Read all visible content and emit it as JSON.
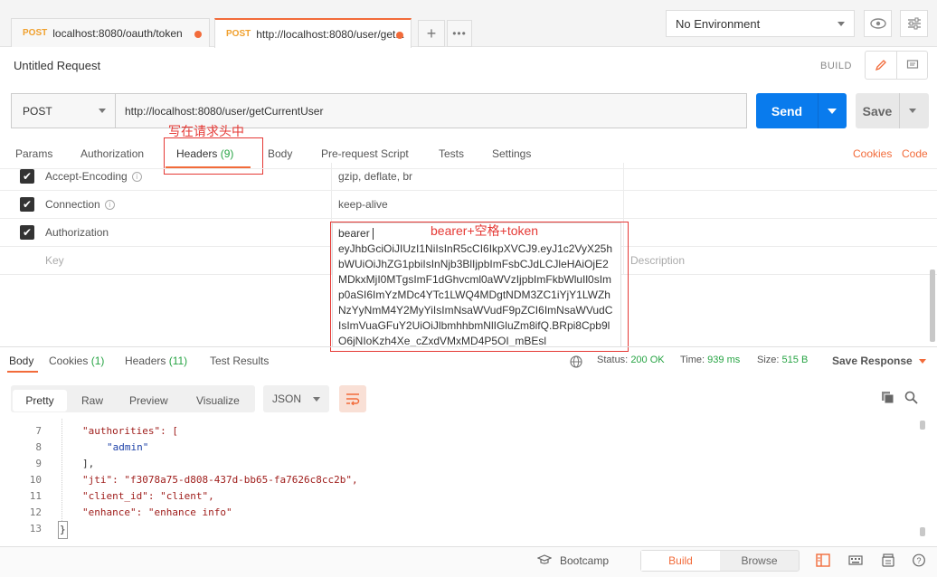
{
  "tabs": [
    {
      "method": "POST",
      "url": "localhost:8080/oauth/token"
    },
    {
      "method": "POST",
      "url": "http://localhost:8080/user/get..."
    }
  ],
  "environment": {
    "selected": "No Environment"
  },
  "request": {
    "title": "Untitled Request",
    "build_label": "BUILD",
    "method": "POST",
    "url": "http://localhost:8080/user/getCurrentUser",
    "send_label": "Send",
    "save_label": "Save"
  },
  "request_tabs": {
    "params": "Params",
    "authorization": "Authorization",
    "headers": "Headers",
    "headers_count": "(9)",
    "body": "Body",
    "prerequest": "Pre-request Script",
    "tests": "Tests",
    "settings": "Settings",
    "cookies": "Cookies",
    "code": "Code"
  },
  "annotations": {
    "headers_note": "写在请求头中",
    "token_note": "bearer+空格+token"
  },
  "headers": [
    {
      "key": "Accept-Encoding",
      "value": "gzip, deflate, br",
      "checked": true
    },
    {
      "key": "Connection",
      "value": "keep-alive",
      "checked": true
    },
    {
      "key": "Authorization",
      "value": "bearer",
      "checked": true
    }
  ],
  "header_placeholders": {
    "key": "Key",
    "description": "Description"
  },
  "token_value": "eyJhbGciOiJIUzI1NiIsInR5cCI6IkpXVCJ9.eyJ1c2VyX25hbWUiOiJhZG1pbiIsInNjb3BlIjpbImFsbCJdLCJleHAiOjE2MDkxMjI0MTgsImF1dGhvcml0aWVzIjpbImFkbWluIl0sImp0aSI6ImYzMDc4YTc1LWQ4MDgtNDM3ZC1iYjY1LWZhNzYyNmM4Y2MyYiIsImNsaWVudF9pZCI6ImNsaWVudCIsImVuaGFuY2UiOiJlbmhhbmNlIGluZm8ifQ.BRpi8Cpb9lO6jNIoKzh4Xe_cZxdVMxMD4P5OI_mBEsl",
  "response_tabs": {
    "body": "Body",
    "cookies": "Cookies",
    "cookies_count": "(1)",
    "headers": "Headers",
    "headers_count": "(11)",
    "test_results": "Test Results"
  },
  "response_status": {
    "status_label": "Status:",
    "status_value": "200 OK",
    "time_label": "Time:",
    "time_value": "939 ms",
    "size_label": "Size:",
    "size_value": "515 B",
    "save_response": "Save Response"
  },
  "format_buttons": {
    "pretty": "Pretty",
    "raw": "Raw",
    "preview": "Preview",
    "visualize": "Visualize",
    "json": "JSON"
  },
  "code_lines": [
    {
      "n": "7",
      "text": "\"authorities\": ["
    },
    {
      "n": "8",
      "text": "\"admin\""
    },
    {
      "n": "9",
      "text": "],"
    },
    {
      "n": "10",
      "text": "\"jti\": \"f3078a75-d808-437d-bb65-fa7626c8cc2b\","
    },
    {
      "n": "11",
      "text": "\"client_id\": \"client\","
    },
    {
      "n": "12",
      "text": "\"enhance\": \"enhance info\""
    },
    {
      "n": "13",
      "text": "}"
    }
  ],
  "footer": {
    "bootcamp": "Bootcamp",
    "build": "Build",
    "browse": "Browse"
  },
  "colors": {
    "accent": "#f26b3a",
    "send": "#097bed",
    "status_ok": "#27a444",
    "annotation": "#e53935"
  }
}
